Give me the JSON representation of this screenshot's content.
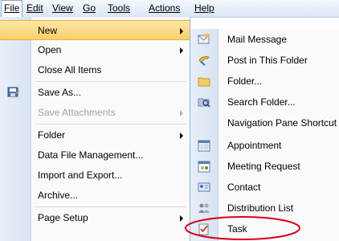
{
  "menubar": {
    "items": [
      {
        "label": "File",
        "active": true
      },
      {
        "label": "Edit"
      },
      {
        "label": "View"
      },
      {
        "label": "Go"
      },
      {
        "label": "Tools"
      },
      {
        "label": "Actions"
      },
      {
        "label": "Help"
      }
    ]
  },
  "file_menu": {
    "items": [
      {
        "label": "New",
        "highlighted": true,
        "submenu": true
      },
      {
        "label": "Open",
        "submenu": true
      },
      {
        "label": "Close All Items"
      },
      {
        "label": "Save As...",
        "icon": "save-as-icon"
      },
      {
        "label": "Save Attachments",
        "disabled": true,
        "submenu": true
      },
      {
        "label": "Folder",
        "submenu": true
      },
      {
        "label": "Data File Management..."
      },
      {
        "label": "Import and Export..."
      },
      {
        "label": "Archive..."
      },
      {
        "label": "Page Setup",
        "submenu": true
      }
    ]
  },
  "new_submenu": {
    "items": [
      {
        "label": "Mail Message",
        "icon": "mail-message-icon"
      },
      {
        "label": "Post in This Folder",
        "icon": "post-in-folder-icon"
      },
      {
        "label": "Folder...",
        "icon": "folder-icon"
      },
      {
        "label": "Search Folder...",
        "icon": "search-folder-icon"
      },
      {
        "label": "Navigation Pane Shortcut"
      },
      {
        "label": "Appointment",
        "icon": "calendar-icon"
      },
      {
        "label": "Meeting Request",
        "icon": "meeting-request-icon"
      },
      {
        "label": "Contact",
        "icon": "contact-card-icon"
      },
      {
        "label": "Distribution List",
        "icon": "distribution-list-icon"
      },
      {
        "label": "Task",
        "icon": "task-icon",
        "circled": true
      }
    ]
  },
  "colors": {
    "highlight": "#f9cf6a",
    "annotation": "#d9001b",
    "menubar": "#dbe6f5"
  }
}
